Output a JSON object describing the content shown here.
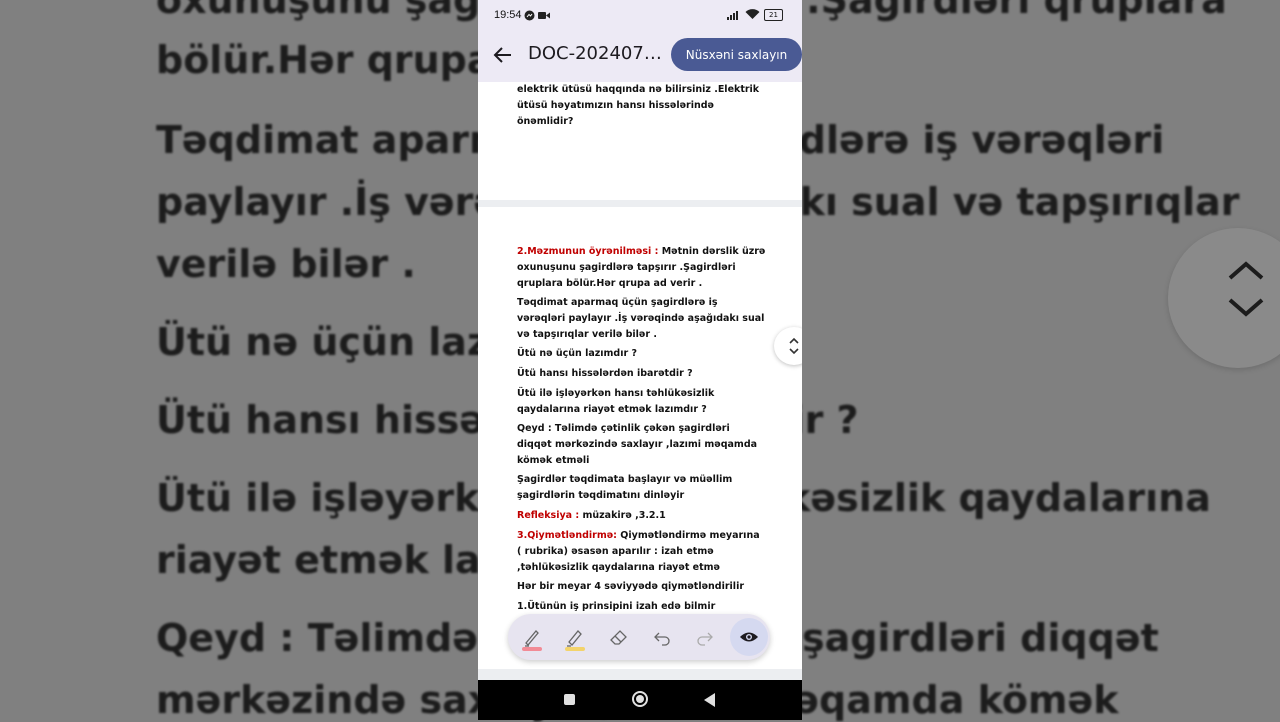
{
  "background": {
    "lines": [
      "oxunuşunu şagirdlərə tapşırır .Şagirdləri qruplara",
      "bölür.Hər qrupa ad verir .",
      "Təqdimat aparmaq üçün şagirdlərə iş vərəqləri",
      "paylayır .İş vərəqində aşağıdakı sual və tapşırıqlar",
      "verilə bilər .",
      "Ütü nə üçün lazımdır ?",
      "Ütü hansı hissələrdən ibarətdir ?",
      "Ütü ilə işləyərkən hansı təhlükəsizlik qaydalarına",
      "riayət etmək lazımdır ?",
      "Qeyd : Təlimdə çətinlik çəkən şagirdləri diqqət",
      "mərkəzində saxlayır ,lazımi məqamda kömək"
    ]
  },
  "status_bar": {
    "time": "19:54",
    "battery": "21"
  },
  "app_bar": {
    "title": "DOC-2024071...",
    "save_label": "Nüsxəni saxlayın"
  },
  "document": {
    "page1_text": "elektrik ütüsü haqqında nə bilirsiniz .Elektrik ütüsü həyatımızın hansı hissələrində önəmlidir?",
    "section2_heading": "2.Məzmunun öyrənilməsi :",
    "section2_text": " Mətnin dərslik üzrə oxunuşunu şagirdlərə tapşırır .Şagirdləri qruplara bölür.Hər qrupa ad verir .",
    "p_teqdimat": "Təqdimat aparmaq üçün şagirdlərə iş vərəqləri paylayır .İş vərəqində aşağıdakı sual və tapşırıqlar verilə bilər .",
    "q1": "Ütü nə üçün lazımdır ?",
    "q2": "Ütü hansı hissələrdən ibarətdir ?",
    "q3": "Ütü ilə işləyərkən hansı təhlükəsizlik qaydalarına riayət etmək lazımdır ?",
    "qeyd": "Qeyd : Təlimdə çətinlik çəkən şagirdləri diqqət mərkəzində saxlayır ,lazımi məqamda kömək etməli",
    "sagirdler": "Şagirdlər təqdimata başlayır və müəllim şagirdlərin təqdimatını dinləyir",
    "refleksiya_label": "Refleksiya :",
    "refleksiya_text": " müzakirə ,3.2.1",
    "section3_heading": "3.Qiymətləndirmə:",
    "section3_text": " Qiymətləndirmə meyarına ( rubrika) əsasən aparılır : izah etmə ,təhlükəsizlik qaydalarına riayət etmə",
    "meyar": "Hər bir meyar 4 səviyyədə qiymətləndirilir",
    "item1": "1.Ütünün iş prinsipini izah edə bilmir"
  },
  "colors": {
    "accent": "#4a5a94",
    "heading_red": "#c00000",
    "pen_red": "#f28b96",
    "highlighter_yellow": "#f3d36b"
  },
  "toolbar": {
    "tools": [
      "pen-icon",
      "highlighter-icon",
      "eraser-icon",
      "undo-icon",
      "redo-icon",
      "eye-icon"
    ]
  }
}
